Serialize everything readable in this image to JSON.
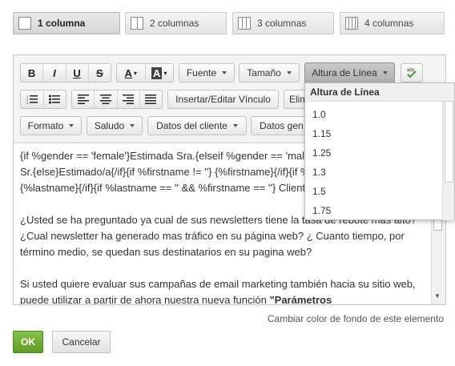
{
  "columns": [
    {
      "label": "1 columna",
      "active": true
    },
    {
      "label": "2 columnas",
      "active": false
    },
    {
      "label": "3 columnas",
      "active": false
    },
    {
      "label": "4 columnas",
      "active": false
    }
  ],
  "toolbar": {
    "bold": "B",
    "italic": "I",
    "underline": "U",
    "strike": "S",
    "text_color": "A",
    "bg_color": "A",
    "font": "Fuente",
    "size": "Tamaño",
    "line_height": "Altura de Línea",
    "insert_link": "Insertar/Editar Vínculo",
    "unlink_partial": "Elim",
    "format": "Formato",
    "greeting": "Saludo",
    "client_data": "Datos del cliente",
    "more_data_partial": "Datos gen"
  },
  "dropdown": {
    "title": "Altura de Línea",
    "options": [
      "1.0",
      "1.15",
      "1.25",
      "1.3",
      "1.5",
      "1.75"
    ]
  },
  "content": {
    "line1": "{if %gender == 'female'}Estimada Sra.{elseif %gender == 'male'}Estimado",
    "line2": "Sr.{else}Estimado/a{/if}{if %firstname != ''} {%firstname}{/if}{if %lastname != ''}",
    "line3": "{%lastname}{/if}{if %lastname == '' && %firstname == ''} Cliente{/if},",
    "para2": "¿Usted se ha preguntado ya cual de sus newsletters tiene la tasa de rebote mas alto? ¿Cual newsletter ha generado mas tráfico en su página web? ¿ Cuanto tiempo, por término medio, se quedan sus destinatarios en su pagina web?",
    "para3_start": "Si usted quiere evaluar sus campañas de email marketing también hacia su sitio web, puede utilizar a partir de ahora nuestra nueva función ",
    "para3_bold": "\"Parámetros"
  },
  "footer": {
    "bg_hint": "Cambiar color de fondo de este elemento",
    "ok": "OK",
    "cancel": "Cancelar"
  },
  "colors": {
    "ok_green": "#6aa82f"
  }
}
